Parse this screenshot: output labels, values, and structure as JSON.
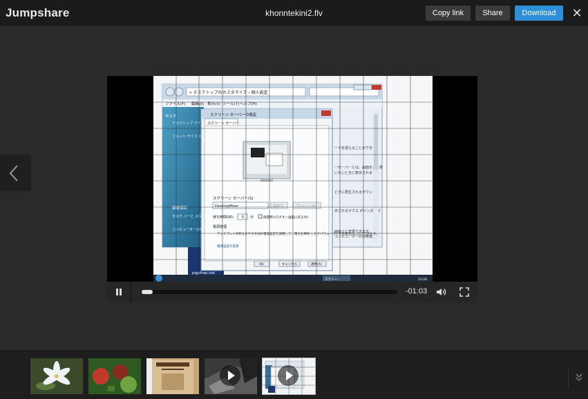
{
  "header": {
    "brand": "Jumpshare",
    "file_name": "khonntekini2.flv",
    "copy_link_label": "Copy link",
    "share_label": "Share",
    "download_label": "Download",
    "close_icon": "close-icon"
  },
  "player": {
    "time_remaining": "-01:03",
    "progress": 0.04,
    "state": "playing"
  },
  "frame_screen": {
    "window_breadcrumb": "« デスクトップのカスタマイズ › 個人設定",
    "menu_file": "ファイル(F)",
    "menu_edit": "編集(E)",
    "menu_view": "表示(V)",
    "menu_tools": "ツール(T)",
    "menu_help": "ヘルプ(H)",
    "task_header": "タスク",
    "task_item1": "デスクトップ アイコン の変更",
    "task_item2": "フォント サイズ (DPI)",
    "related_header": "関連項目",
    "related_item1": "タスク バーと スタート メニュー",
    "related_item2": "コンピューターの簡単操作",
    "side_text1": "ーマを調えることができま",
    "side_text2": "ーセーバーとは、画面を最も表",
    "side_text3": "いないときに表示されます",
    "side_text4": "ときに再生されるサウン",
    "side_text5": "示されるマウス ポインタの表",
    "side_text6": "画面上に変更できます。",
    "side_text7": "コンピューターの効果値、",
    "dialog_title": "スクリーン セーバーの設定",
    "dialog_tab": "スクリーン セーバー",
    "screensaver_label": "スクリーン セーバー(S)",
    "screensaver_value": "DesktopMixer",
    "settings_button": "設定(T)...",
    "preview_button": "プレビュー(V)",
    "wait_label": "待ち時間(W):",
    "wait_value": "5",
    "wait_unit": "分",
    "resume_label": "再開時にログオン画面に戻る(R)",
    "power_header": "電源管理",
    "power_text": "ディスプレイの明るさやその他の電源設定を調整して、電力を節約\nしたりパフォーマンスを最大にしたりできます。",
    "power_link": "電源設定の変更",
    "ok_button": "OK",
    "cancel_button": "キャンセル",
    "apply_button": "適用(A)",
    "watermark": "pigsfree.net",
    "taskbar_item": "スクリー...",
    "clock": "23:26"
  },
  "thumbnails": [
    {
      "name": "thumbnail-lily",
      "icon": "",
      "colors": [
        "#3a4a2a",
        "#e9eef2"
      ]
    },
    {
      "name": "thumbnail-tomatoes",
      "icon": "",
      "colors": [
        "#2e5a22",
        "#c0392b"
      ]
    },
    {
      "name": "thumbnail-wanted-poster",
      "icon": "",
      "colors": [
        "#c9a878",
        "#5a3b1e"
      ]
    },
    {
      "name": "thumbnail-video-dark",
      "icon": "play-icon",
      "colors": [
        "#3a3a3a",
        "#777"
      ]
    },
    {
      "name": "thumbnail-video-current",
      "icon": "play-icon",
      "colors": [
        "#dfe6ea",
        "#3a6f99"
      ]
    }
  ],
  "colors": {
    "accent": "#2d90d9",
    "topbar": "#1b1b1b",
    "background": "#2a2a2a"
  }
}
